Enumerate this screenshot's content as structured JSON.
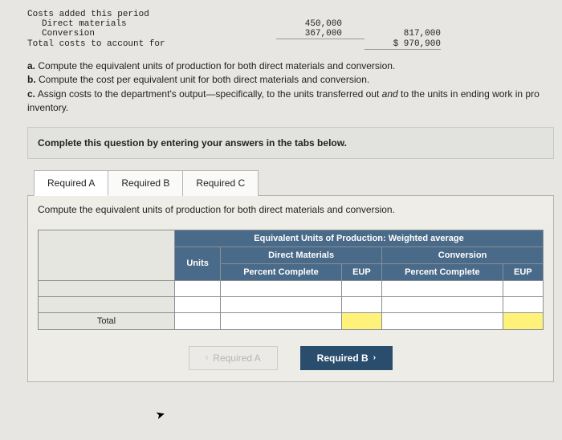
{
  "costs": {
    "header": "Costs added this period",
    "rows": [
      {
        "label": "Direct materials",
        "col1": "450,000",
        "col2": ""
      },
      {
        "label": "Conversion",
        "col1": "367,000",
        "col2": "817,000"
      }
    ],
    "total_label": "Total costs to account for",
    "total_value": "$ 970,900"
  },
  "questions": {
    "a": "a.",
    "a_text": " Compute the equivalent units of production for both direct materials and conversion.",
    "b": "b.",
    "b_text": " Compute the cost per equivalent unit for both direct materials and conversion.",
    "c": "c.",
    "c_text_pre": " Assign costs to the department's output—specifically, to the units transferred out ",
    "c_and": "and",
    "c_text_post": " to the units in ending work in pro",
    "inventory": "inventory."
  },
  "complete_instruction": "Complete this question by entering your answers in the tabs below.",
  "tabs": {
    "a": "Required A",
    "b": "Required B",
    "c": "Required C"
  },
  "tab_instruction": "Compute the equivalent units of production for both direct materials and conversion.",
  "table": {
    "title": "Equivalent Units of Production: Weighted average",
    "units": "Units",
    "direct_materials": "Direct Materials",
    "conversion": "Conversion",
    "percent_complete": "Percent Complete",
    "eup": "EUP",
    "total": "Total"
  },
  "nav": {
    "prev": "Required A",
    "next": "Required B"
  }
}
